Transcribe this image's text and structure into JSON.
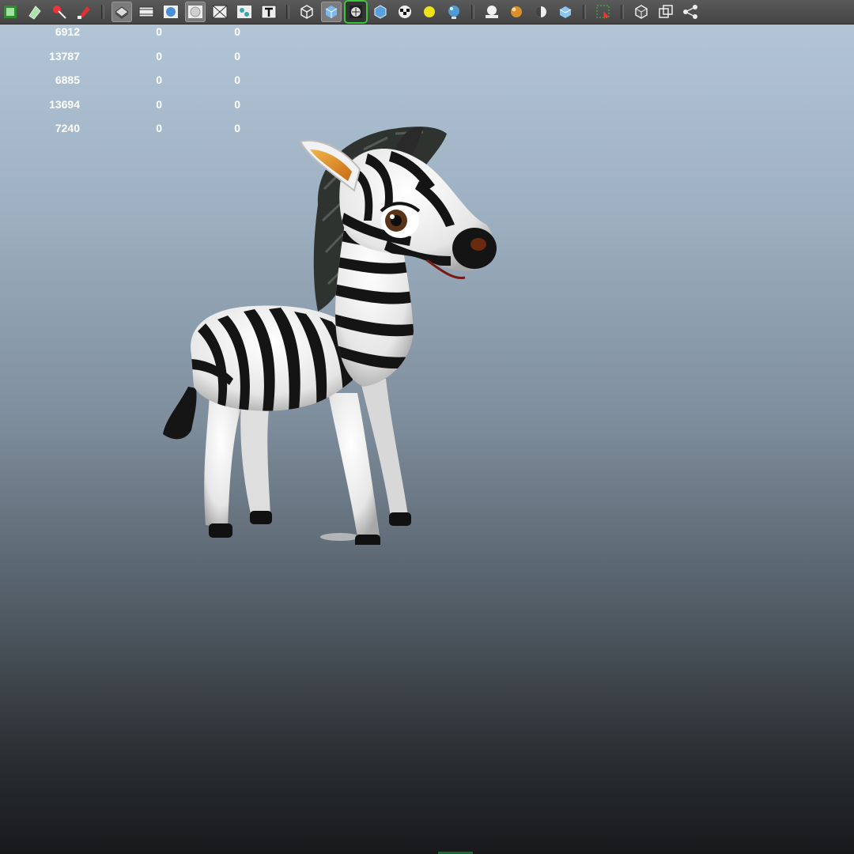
{
  "toolbar": {
    "buttons": [
      {
        "icon": "film-strip-icon"
      },
      {
        "icon": "paint-icon"
      },
      {
        "icon": "magic-tool-icon"
      },
      {
        "icon": "brush-icon"
      },
      {
        "icon": "separator"
      },
      {
        "icon": "wireframe-on-shaded-icon",
        "active": true
      },
      {
        "icon": "film-gate-icon"
      },
      {
        "icon": "smooth-shade-icon"
      },
      {
        "icon": "flat-shade-icon",
        "active": true
      },
      {
        "icon": "xray-icon"
      },
      {
        "icon": "joints-icon"
      },
      {
        "icon": "text-icon"
      },
      {
        "icon": "separator"
      },
      {
        "icon": "cube-wire-icon"
      },
      {
        "icon": "cube-shaded-icon",
        "active": true
      },
      {
        "icon": "texture-toggle-icon",
        "selected": true
      },
      {
        "icon": "cube-default-icon"
      },
      {
        "icon": "checker-icon"
      },
      {
        "icon": "light-bulb-icon"
      },
      {
        "icon": "sphere-light-icon"
      },
      {
        "icon": "separator"
      },
      {
        "icon": "shadow-icon"
      },
      {
        "icon": "material-ball-icon"
      },
      {
        "icon": "half-sphere-icon"
      },
      {
        "icon": "cube-blue-icon"
      },
      {
        "icon": "separator"
      },
      {
        "icon": "select-region-icon"
      },
      {
        "icon": "separator"
      },
      {
        "icon": "isolate-cube-icon"
      },
      {
        "icon": "copy-frame-icon"
      },
      {
        "icon": "share-graph-icon"
      }
    ]
  },
  "hud": {
    "rows": [
      [
        "6912",
        "0",
        "0"
      ],
      [
        "13787",
        "0",
        "0"
      ],
      [
        "6885",
        "0",
        "0"
      ],
      [
        "13694",
        "0",
        "0"
      ],
      [
        "7240",
        "0",
        "0"
      ]
    ]
  },
  "colors": {
    "viewport_top": "#b2c5d7",
    "viewport_bottom": "#18191b",
    "toolbar_bg": "#4e4e4e",
    "hud_text": "#ffffff",
    "selected_outline": "#38c838"
  },
  "viewport": {
    "subject": "zebra-3d-model"
  }
}
